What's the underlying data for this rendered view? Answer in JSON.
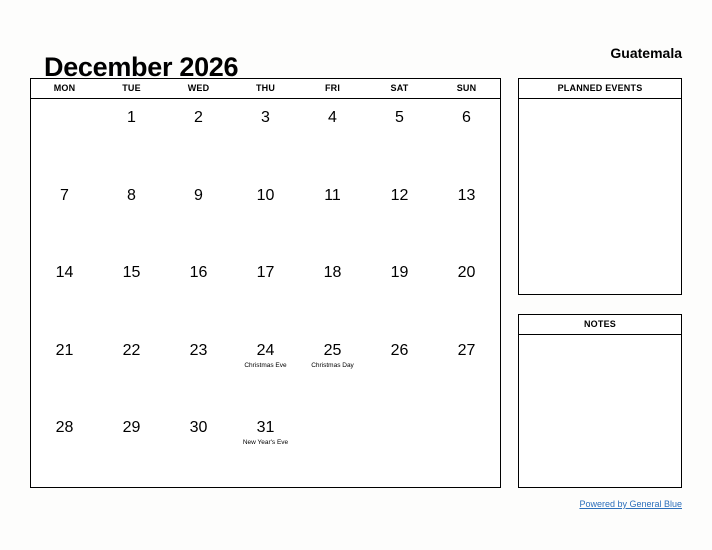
{
  "header": {
    "month_title": "December 2026",
    "locale": "Guatemala"
  },
  "calendar": {
    "weekday_headers": [
      "MON",
      "TUE",
      "WED",
      "THU",
      "FRI",
      "SAT",
      "SUN"
    ],
    "weeks": [
      [
        {
          "day": ""
        },
        {
          "day": "1"
        },
        {
          "day": "2"
        },
        {
          "day": "3"
        },
        {
          "day": "4"
        },
        {
          "day": "5"
        },
        {
          "day": "6"
        }
      ],
      [
        {
          "day": "7"
        },
        {
          "day": "8"
        },
        {
          "day": "9"
        },
        {
          "day": "10"
        },
        {
          "day": "11"
        },
        {
          "day": "12"
        },
        {
          "day": "13"
        }
      ],
      [
        {
          "day": "14"
        },
        {
          "day": "15"
        },
        {
          "day": "16"
        },
        {
          "day": "17"
        },
        {
          "day": "18"
        },
        {
          "day": "19"
        },
        {
          "day": "20"
        }
      ],
      [
        {
          "day": "21"
        },
        {
          "day": "22"
        },
        {
          "day": "23"
        },
        {
          "day": "24",
          "event": "Christmas Eve"
        },
        {
          "day": "25",
          "event": "Christmas Day"
        },
        {
          "day": "26"
        },
        {
          "day": "27"
        }
      ],
      [
        {
          "day": "28"
        },
        {
          "day": "29"
        },
        {
          "day": "30"
        },
        {
          "day": "31",
          "event": "New Year's Eve"
        },
        {
          "day": ""
        },
        {
          "day": ""
        },
        {
          "day": ""
        }
      ]
    ]
  },
  "sidebar": {
    "planned_events_title": "PLANNED EVENTS",
    "notes_title": "NOTES"
  },
  "footer": {
    "link_text": "Powered by General Blue"
  },
  "colors": {
    "page_background": "#fdfdfc",
    "border": "#000000",
    "text": "#000000",
    "link": "#2c6fbb"
  }
}
